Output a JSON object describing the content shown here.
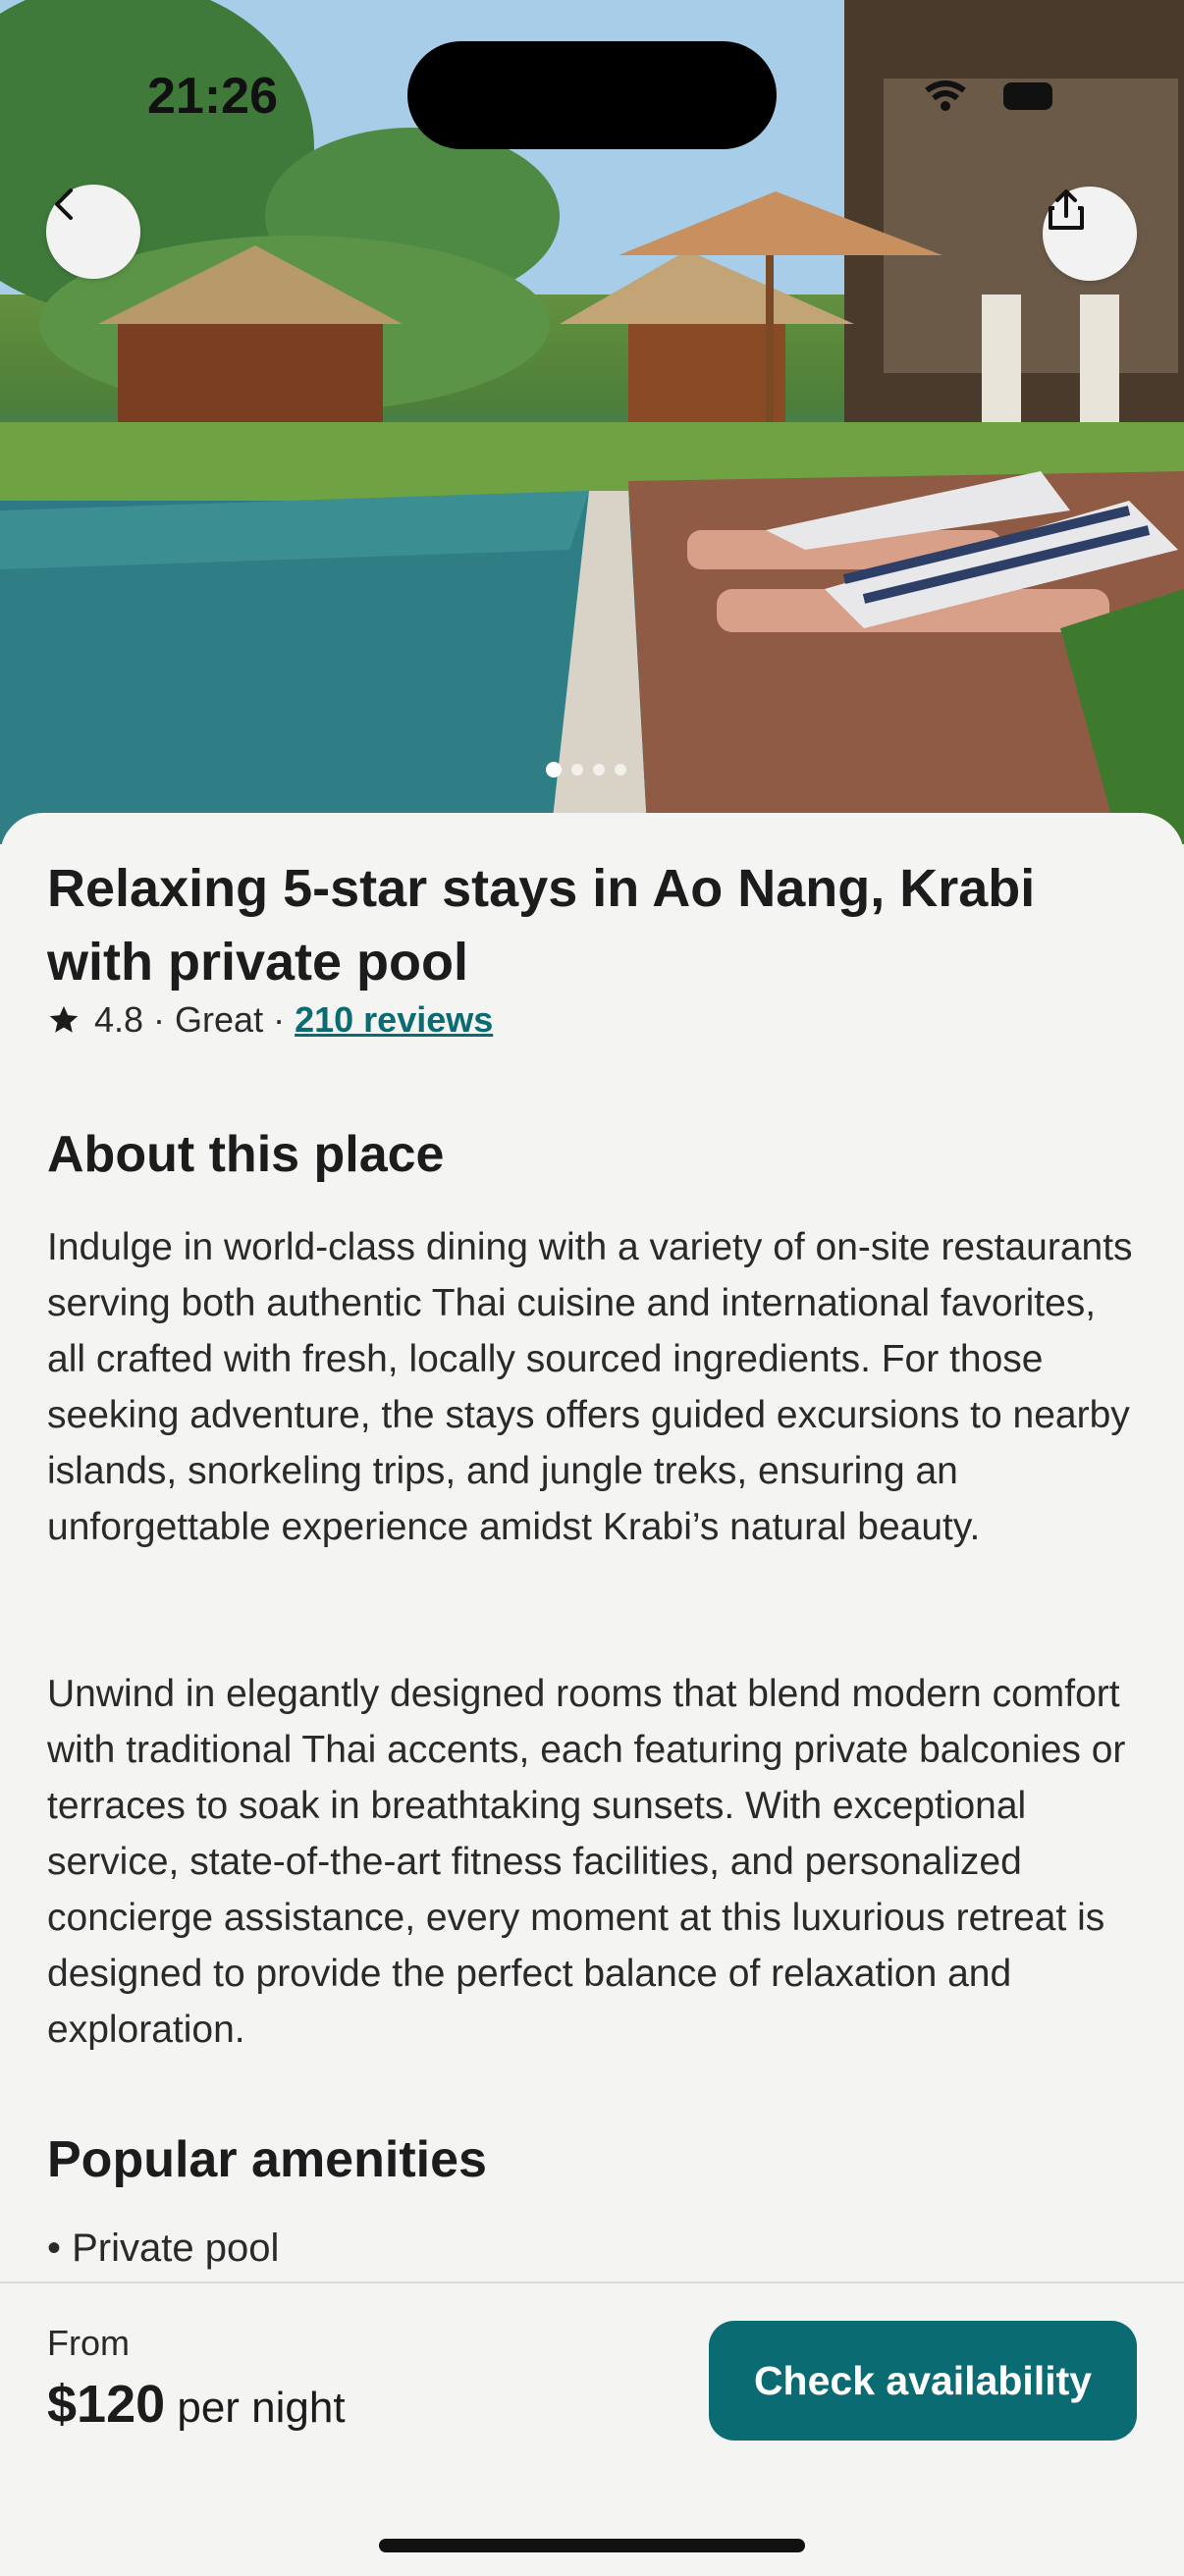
{
  "status_bar": {
    "time": "21:26"
  },
  "hero": {
    "image_subject": "resort pool with loungers and thatched cabanas",
    "carousel_count": 4,
    "carousel_active": 0
  },
  "nav": {
    "back_icon": "chevron-left-icon",
    "share_icon": "share-icon"
  },
  "listing": {
    "title": "Relaxing 5-star stays in Ao Nang, Krabi with private pool",
    "rating": "4.8",
    "rating_sep1": " · ",
    "rating_word": "Great",
    "rating_sep2": " · ",
    "reviews_link": "210 reviews"
  },
  "about": {
    "heading": "About this place",
    "paragraph1": "Indulge in world-class dining with a variety of on-site restaurants serving both authentic Thai cuisine and international favorites, all crafted with fresh, locally sourced ingredients. For those seeking adventure, the stays offers guided excursions to nearby islands, snorkeling trips, and jungle treks, ensuring an unforgettable experience amidst Krabi’s natural beauty.",
    "paragraph2": "Unwind in elegantly designed rooms that blend modern comfort with traditional Thai accents, each featuring private balconies or terraces to soak in breathtaking sunsets. With exceptional service, state-of-the-art fitness facilities, and personalized concierge assistance, every moment at this luxurious retreat is designed to provide the perfect balance of relaxation and exploration."
  },
  "amenities": {
    "heading": "Popular amenities",
    "items": [
      "• Private pool"
    ]
  },
  "booking": {
    "from_label": "From",
    "price": "$120",
    "price_suffix": " per night",
    "cta_label": "Check availability",
    "accent_color": "#0a6b73"
  }
}
